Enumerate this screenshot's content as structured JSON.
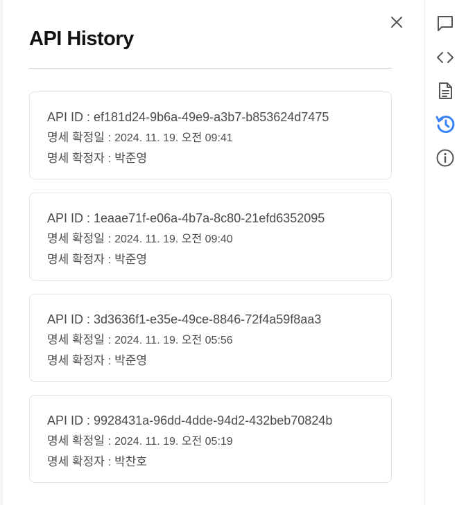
{
  "panel": {
    "title": "API History",
    "close_icon": "close-icon"
  },
  "history": [
    {
      "id_label": "API ID : ",
      "id": "ef181d24-9b6a-49e9-a3b7-b853624d7475",
      "date_label": "명세 확정일 : ",
      "date": "2024. 11. 19. 오전 09:41",
      "author_label": "명세 확정자 : ",
      "author": "박준영"
    },
    {
      "id_label": "API ID : ",
      "id": "1eaae71f-e06a-4b7a-8c80-21efd6352095",
      "date_label": "명세 확정일 : ",
      "date": "2024. 11. 19. 오전 09:40",
      "author_label": "명세 확정자 : ",
      "author": "박준영"
    },
    {
      "id_label": "API ID : ",
      "id": "3d3636f1-e35e-49ce-8846-72f4a59f8aa3",
      "date_label": "명세 확정일 : ",
      "date": "2024. 11. 19. 오전 05:56",
      "author_label": "명세 확정자 : ",
      "author": "박준영"
    },
    {
      "id_label": "API ID : ",
      "id": "9928431a-96dd-4dde-94d2-432beb70824b",
      "date_label": "명세 확정일 : ",
      "date": "2024. 11. 19. 오전 05:19",
      "author_label": "명세 확정자 : ",
      "author": "박찬호"
    }
  ],
  "rail": {
    "items": [
      {
        "icon": "chat-icon",
        "active": false
      },
      {
        "icon": "code-icon",
        "active": false
      },
      {
        "icon": "document-icon",
        "active": false
      },
      {
        "icon": "history-icon",
        "active": true
      },
      {
        "icon": "info-icon",
        "active": false
      }
    ]
  },
  "colors": {
    "active": "#3b82f6",
    "icon": "#555555",
    "title": "#111111",
    "text": "#4b4b4b",
    "border": "#e2e2e2"
  }
}
